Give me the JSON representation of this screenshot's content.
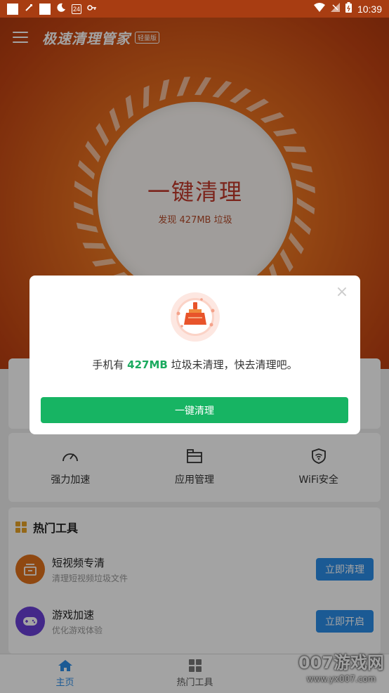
{
  "status_bar": {
    "time": "10:39",
    "date_badge": "24"
  },
  "app": {
    "title": "极速清理管家",
    "badge": "轻量版"
  },
  "hero": {
    "clean_title": "一键清理",
    "clean_sub": "发现 427MB 垃圾"
  },
  "features": [
    {
      "label": "强力加速",
      "icon": "speedometer-icon"
    },
    {
      "label": "应用管理",
      "icon": "folder-icon"
    },
    {
      "label": "WiFi安全",
      "icon": "wifi-shield-icon"
    }
  ],
  "tools": {
    "title": "热门工具",
    "items": [
      {
        "name": "短视频专清",
        "desc": "清理短视频垃圾文件",
        "button": "立即清理",
        "icon_color": "#e0711c"
      },
      {
        "name": "游戏加速",
        "desc": "优化游戏体验",
        "button": "立即开启",
        "icon_color": "#6a3fd6"
      }
    ]
  },
  "bottom_nav": [
    {
      "label": "主页",
      "active": true
    },
    {
      "label": "热门工具",
      "active": false
    }
  ],
  "watermark": {
    "main": "007游戏网",
    "url": "www.yx007.com"
  },
  "dialog": {
    "message_prefix": "手机有 ",
    "size": "427MB",
    "message_suffix": " 垃圾未清理，快去清理吧。",
    "button": "一键清理",
    "close": "×"
  },
  "colors": {
    "accent_green": "#17b463",
    "accent_blue": "#2b8de8",
    "hero_orange": "#e8701f",
    "title_red": "#c0392b"
  }
}
